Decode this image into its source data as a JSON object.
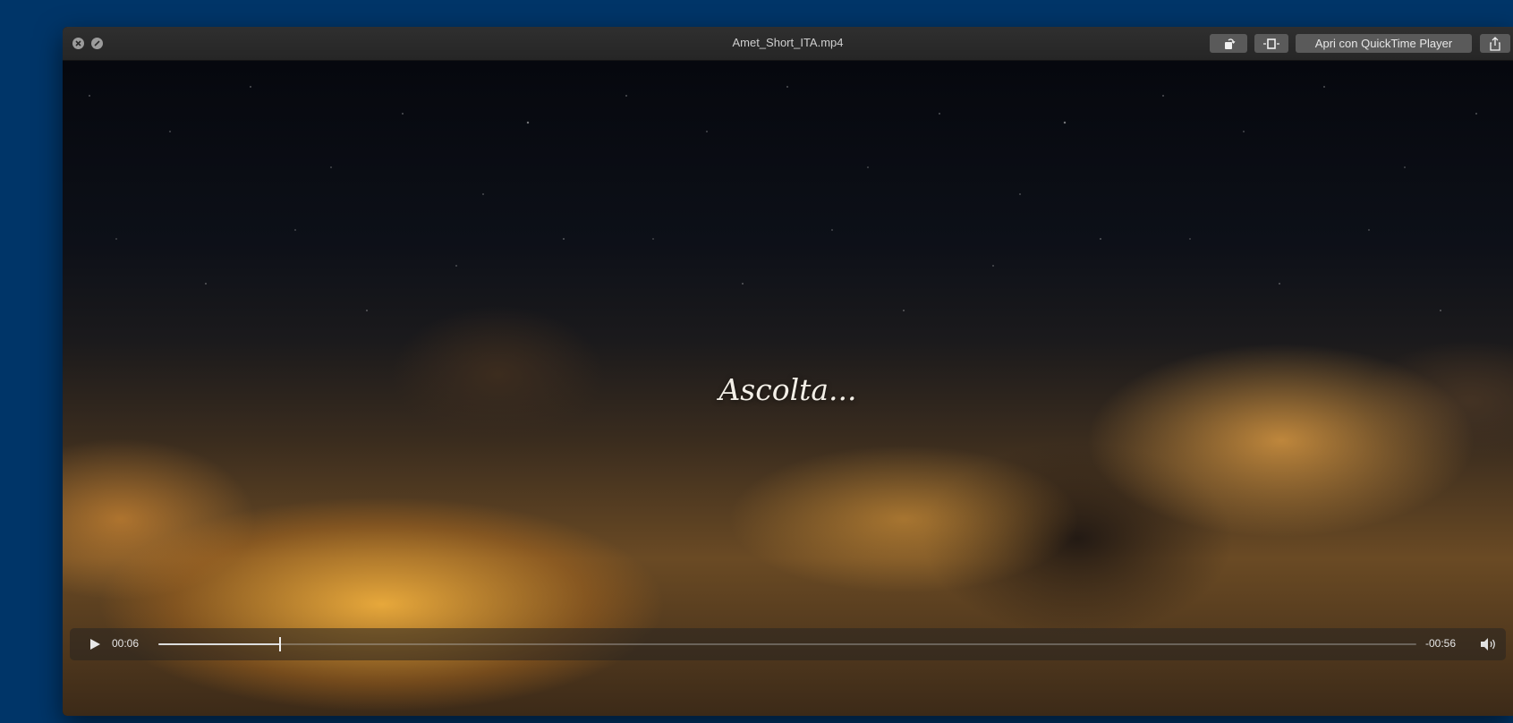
{
  "window": {
    "title": "Amet_Short_ITA.mp4"
  },
  "toolbar": {
    "open_with_label": "Apri con QuickTime Player",
    "icons": [
      "rotate-icon",
      "trim-icon",
      "share-icon"
    ]
  },
  "video": {
    "caption": "Ascolta..."
  },
  "playback": {
    "elapsed": "00:06",
    "remaining": "-00:56",
    "progress": 0.0968,
    "icons": [
      "play-icon",
      "volume-icon"
    ]
  },
  "colors": {
    "desktop": "#003568",
    "titlebar": "#2b2b2b",
    "button": "#5a5a5a"
  }
}
